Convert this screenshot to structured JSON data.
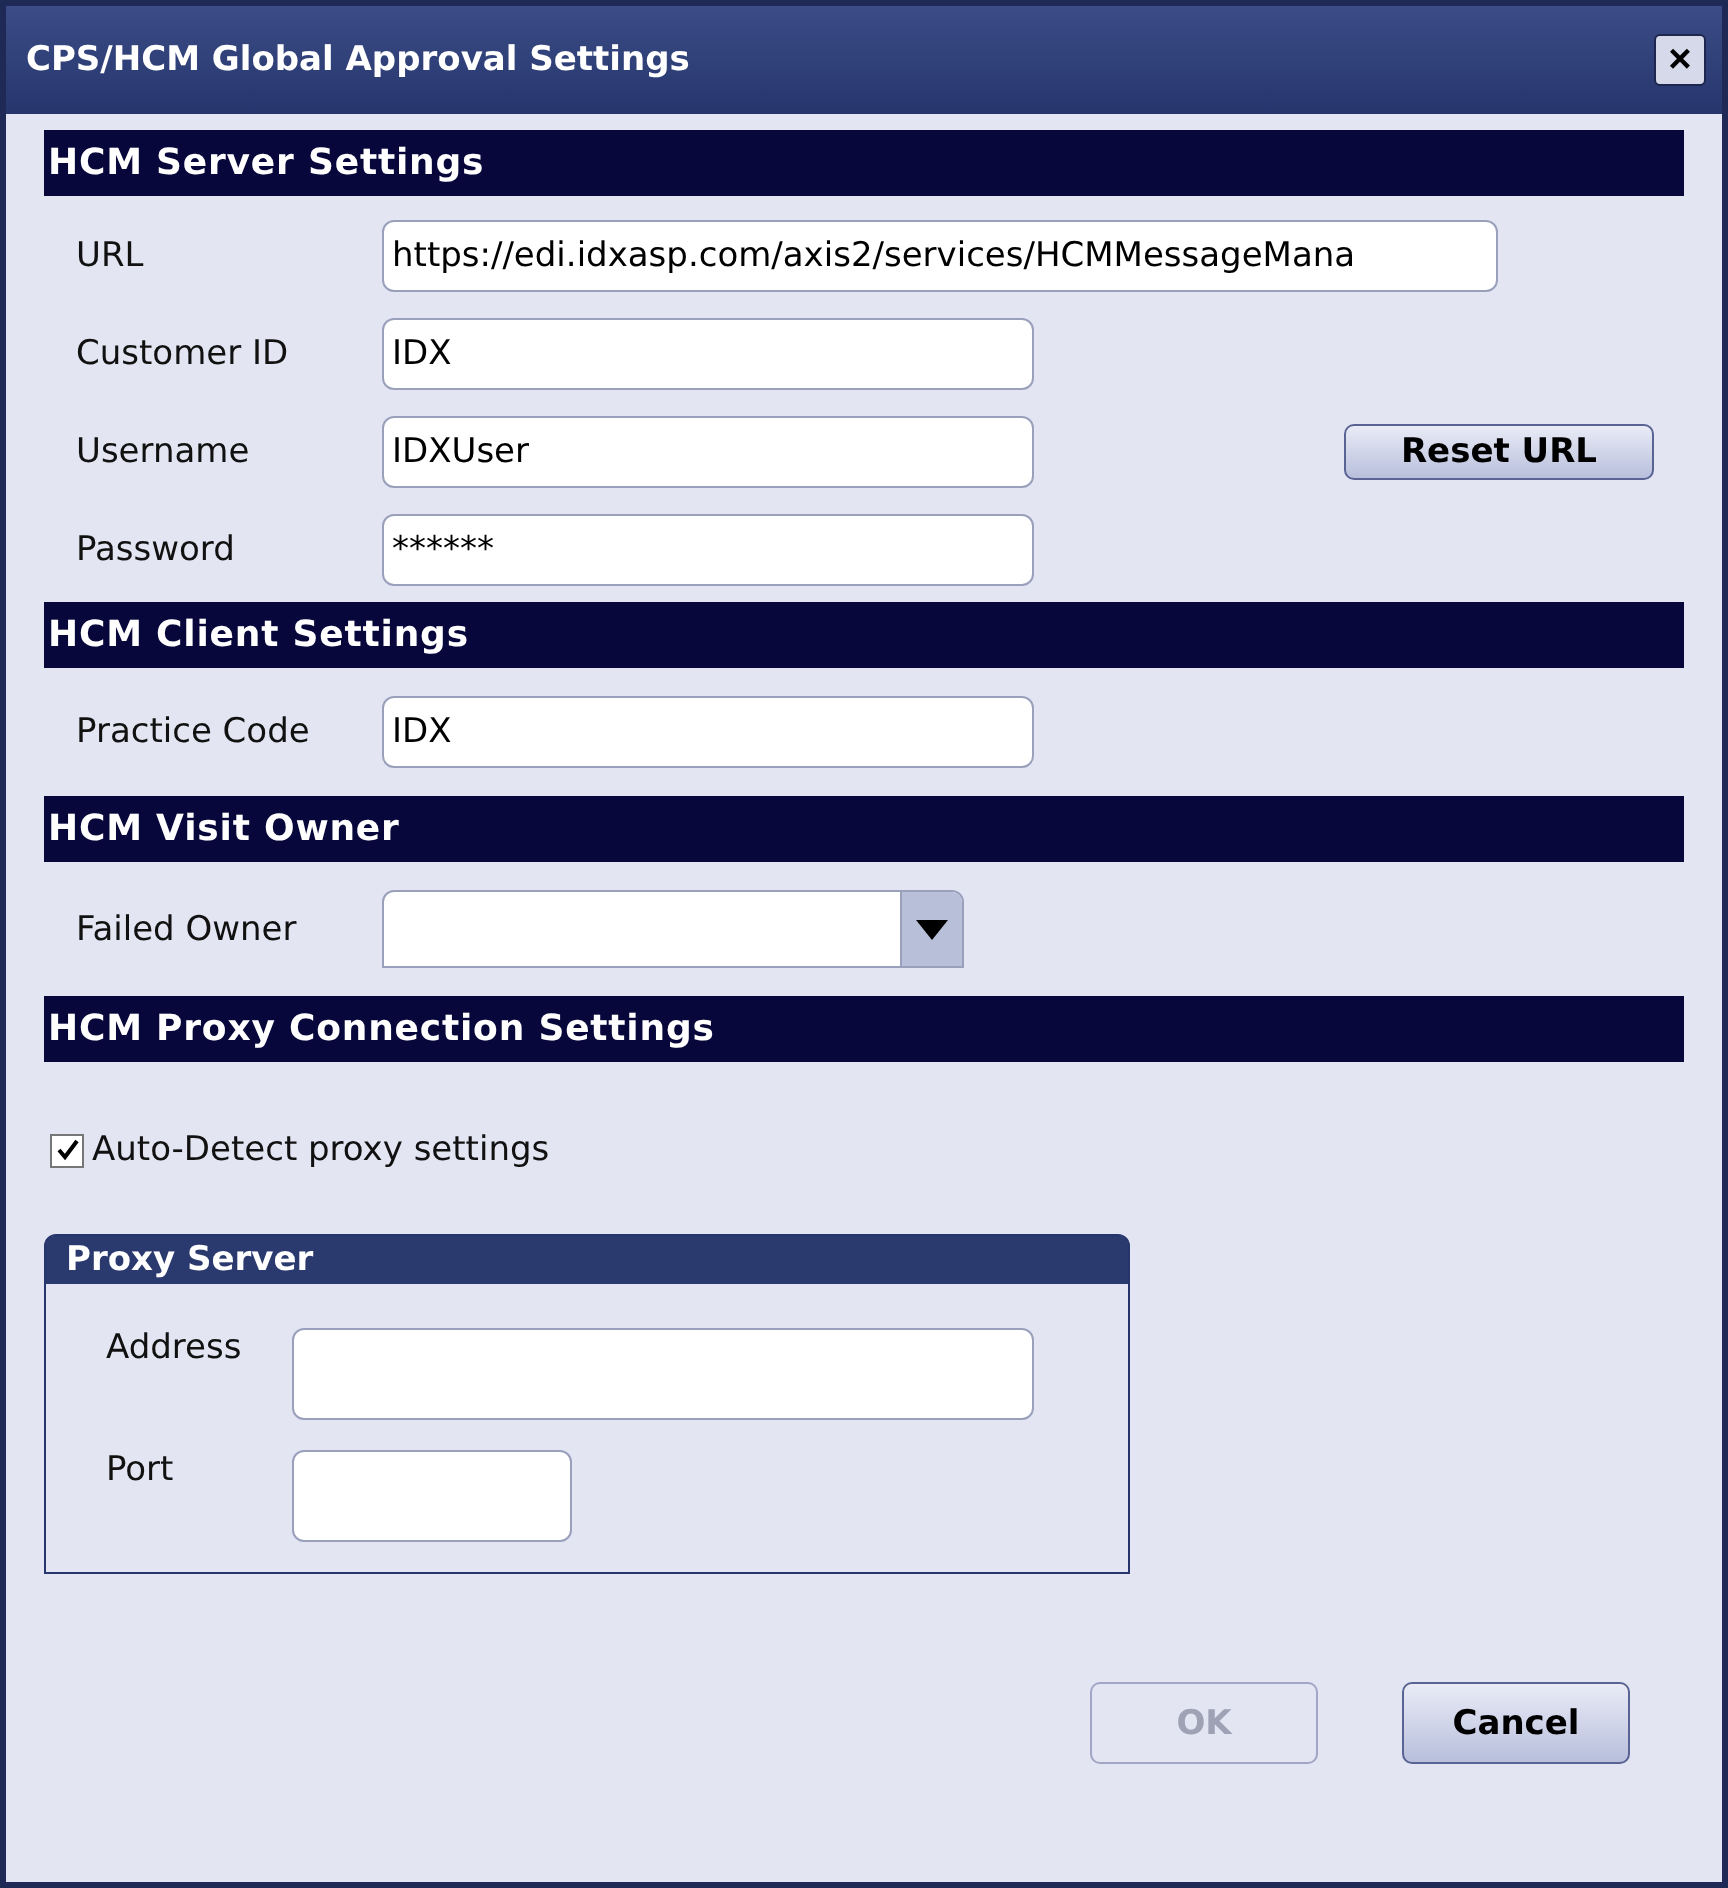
{
  "window": {
    "title": "CPS/HCM Global Approval Settings",
    "close": "×"
  },
  "server": {
    "title": "HCM Server Settings",
    "fields": [
      {
        "label": "URL",
        "value": "https://edi.idxasp.com/axis2/services/HCMMessageMana"
      },
      {
        "label": "Customer ID",
        "value": "IDX"
      },
      {
        "label": "Username",
        "value": "IDXUser"
      },
      {
        "label": "Password",
        "value": "******"
      }
    ],
    "reset_button": "Reset URL"
  },
  "client": {
    "title": "HCM Client Settings",
    "fields": [
      {
        "label": "Practice Code",
        "value": "IDX"
      }
    ]
  },
  "visit_owner": {
    "title": "HCM Visit Owner",
    "label": "Failed Owner"
  },
  "proxy": {
    "title": "HCM Proxy Connection Settings",
    "auto_detect": {
      "label": "Auto-Detect proxy settings",
      "checked": true
    },
    "server_group": {
      "title": "Proxy Server",
      "fields": [
        {
          "label": "Address"
        },
        {
          "label": "Port"
        }
      ]
    }
  },
  "buttons": [
    {
      "label": "OK",
      "disabled": true
    },
    {
      "label": "Cancel",
      "disabled": false
    }
  ]
}
